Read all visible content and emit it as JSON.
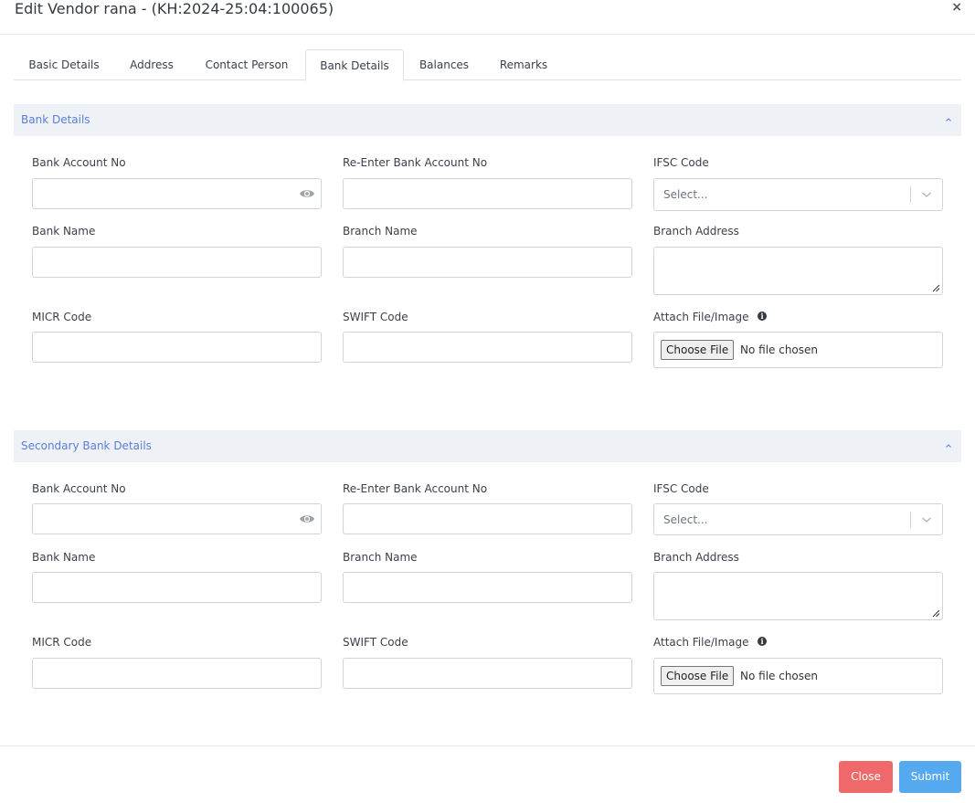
{
  "modal": {
    "title": "Edit Vendor rana - (KH:2024-25:04:100065)",
    "close_symbol": "×"
  },
  "tabs": [
    {
      "label": "Basic Details",
      "active": false
    },
    {
      "label": "Address",
      "active": false
    },
    {
      "label": "Contact Person",
      "active": false
    },
    {
      "label": "Bank Details",
      "active": true
    },
    {
      "label": "Balances",
      "active": false
    },
    {
      "label": "Remarks",
      "active": false
    }
  ],
  "primary": {
    "title": "Bank Details",
    "bank_account_no_label": "Bank Account No",
    "bank_account_no_value": "",
    "reenter_label": "Re-Enter Bank Account No",
    "reenter_value": "",
    "ifsc_label": "IFSC Code",
    "ifsc_placeholder": "Select...",
    "bank_name_label": "Bank Name",
    "bank_name_value": "",
    "branch_name_label": "Branch Name",
    "branch_name_value": "",
    "branch_address_label": "Branch Address",
    "branch_address_value": "",
    "micr_label": "MICR Code",
    "micr_value": "",
    "swift_label": "SWIFT Code",
    "swift_value": "",
    "attach_label": "Attach File/Image",
    "choose_file_label": "Choose File",
    "file_status": "No file chosen"
  },
  "secondary": {
    "title": "Secondary Bank Details",
    "bank_account_no_label": "Bank Account No",
    "bank_account_no_value": "",
    "reenter_label": "Re-Enter Bank Account No",
    "reenter_value": "",
    "ifsc_label": "IFSC Code",
    "ifsc_placeholder": "Select...",
    "bank_name_label": "Bank Name",
    "bank_name_value": "",
    "branch_name_label": "Branch Name",
    "branch_name_value": "",
    "branch_address_label": "Branch Address",
    "branch_address_value": "",
    "micr_label": "MICR Code",
    "micr_value": "",
    "swift_label": "SWIFT Code",
    "swift_value": "",
    "attach_label": "Attach File/Image",
    "choose_file_label": "Choose File",
    "file_status": "No file chosen"
  },
  "footer": {
    "close_label": "Close",
    "submit_label": "Submit"
  },
  "colors": {
    "section_title": "#5a7fd6",
    "section_bg": "#eef1f6",
    "close_button": "#f0696a",
    "submit_button": "#55a9ef"
  },
  "icons": {
    "close": "close-icon",
    "collapse": "chevron-up-icon",
    "show_password": "eye-icon",
    "dropdown": "chevron-down-icon",
    "info": "info-icon"
  }
}
